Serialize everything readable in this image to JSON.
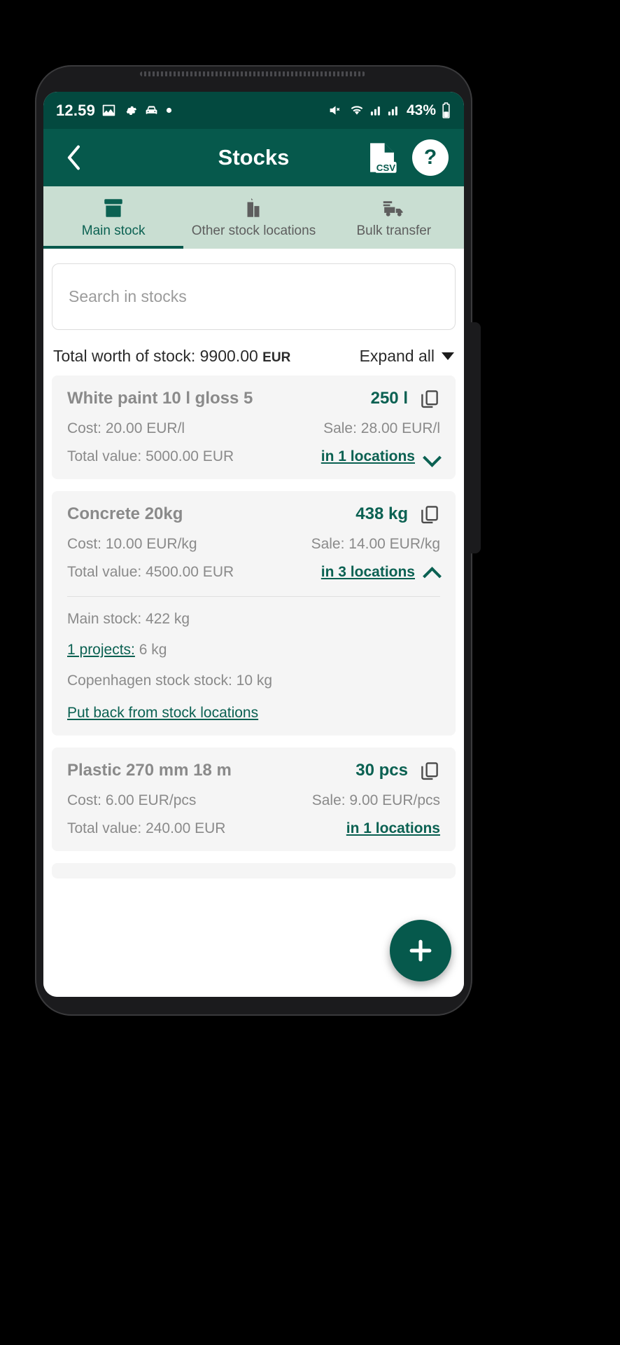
{
  "status_bar": {
    "time": "12.59",
    "left_icons": [
      "image-icon",
      "gear-icon",
      "car-icon",
      "dot-icon"
    ],
    "right_icons": [
      "mute-vibrate-icon",
      "wifi-icon",
      "signal-icon",
      "signal-2-icon"
    ],
    "battery": "43%"
  },
  "app_bar": {
    "back_label": "‹",
    "title": "Stocks",
    "csv_label": "CSV",
    "help_label": "?"
  },
  "tabs": [
    {
      "label": "Main stock",
      "icon": "archive-box-icon",
      "active": true
    },
    {
      "label": "Other stock locations",
      "icon": "buildings-icon",
      "active": false
    },
    {
      "label": "Bulk transfer",
      "icon": "truck-icon",
      "active": false
    }
  ],
  "search": {
    "placeholder": "Search in stocks",
    "value": ""
  },
  "totals": {
    "label": "Total worth of stock: 9900.00",
    "currency": "EUR",
    "expand_all": "Expand all"
  },
  "cards": [
    {
      "title": "White paint 10 l gloss 5",
      "quantity": "250 l",
      "cost": "Cost: 20.00 EUR/l",
      "sale": "Sale: 28.00 EUR/l",
      "total_value": "Total value: 5000.00 EUR",
      "locations_link": "in 1 locations",
      "expanded": false
    },
    {
      "title": "Concrete 20kg",
      "quantity": "438 kg",
      "cost": "Cost: 10.00 EUR/kg",
      "sale": "Sale: 14.00 EUR/kg",
      "total_value": "Total value: 4500.00 EUR",
      "locations_link": "in 3 locations",
      "expanded": true,
      "details": {
        "main_stock": "Main stock: 422 kg",
        "projects_link": "1 projects:",
        "projects_value": " 6 kg",
        "other_location": "Copenhagen stock stock: 10 kg",
        "put_back": "Put back from stock locations"
      }
    },
    {
      "title": "Plastic 270 mm 18 m",
      "quantity": "30 pcs",
      "cost": "Cost: 6.00 EUR/pcs",
      "sale": "Sale: 9.00 EUR/pcs",
      "total_value": "Total value: 240.00 EUR",
      "locations_link": "in 1 locations",
      "expanded": false
    }
  ],
  "fab": {
    "label": "+",
    "icon": "plus-icon"
  },
  "nav_bar": {
    "recents": "recents-icon",
    "home": "home-icon",
    "back": "back-icon"
  },
  "colors": {
    "status_bar": "#03493f",
    "app_bar": "#06594c",
    "tab_bar": "#c9ded2",
    "accent": "#0b6152",
    "card_bg": "#f5f5f5"
  }
}
